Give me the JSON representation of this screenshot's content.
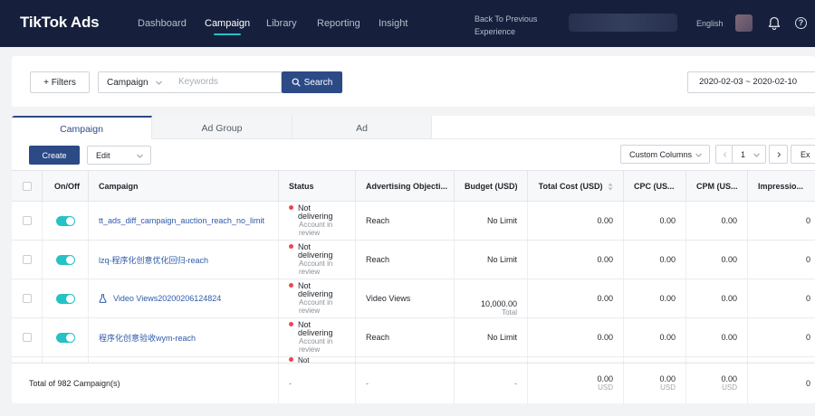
{
  "nav": {
    "logo": "TikTok Ads",
    "items": [
      "Dashboard",
      "Campaign",
      "Library",
      "Reporting",
      "Insight"
    ],
    "back_link": "Back To Previous Experience",
    "language": "English",
    "help": "?"
  },
  "filterbar": {
    "filters_label": "+ Filters",
    "level_select": "Campaign",
    "keywords_placeholder": "Keywords",
    "search_label": "Search",
    "date_range": "2020-02-03  ~  2020-02-10"
  },
  "tabs": [
    "Campaign",
    "Ad Group",
    "Ad"
  ],
  "toolbar": {
    "create_label": "Create",
    "edit_label": "Edit",
    "custom_columns_label": "Custom Columns",
    "page_value": "1",
    "export_label": "Ex"
  },
  "table": {
    "columns": [
      "",
      "On/Off",
      "Campaign",
      "Status",
      "Advertising Objecti...",
      "Budget (USD)",
      "Total Cost (USD)",
      "CPC (US...",
      "CPM (US...",
      "Impressio..."
    ],
    "rows": [
      {
        "campaign": "tt_ads_diff_campaign_auction_reach_no_limit",
        "status": "Not delivering",
        "status_sub": "Account in review",
        "objective": "Reach",
        "budget": "No Limit",
        "budget_sub": "",
        "total_cost": "0.00",
        "cpc": "0.00",
        "cpm": "0.00",
        "impressions": "0",
        "on": true
      },
      {
        "campaign": "lzq-程序化创意优化回归-reach",
        "status": "Not delivering",
        "status_sub": "Account in review",
        "objective": "Reach",
        "budget": "No Limit",
        "budget_sub": "",
        "total_cost": "0.00",
        "cpc": "0.00",
        "cpm": "0.00",
        "impressions": "0",
        "on": true
      },
      {
        "campaign": "Video Views20200206124824",
        "status": "Not delivering",
        "status_sub": "Account in review",
        "objective": "Video Views",
        "budget": "10,000.00",
        "budget_sub": "Total",
        "total_cost": "0.00",
        "cpc": "0.00",
        "cpm": "0.00",
        "impressions": "0",
        "on": true
      },
      {
        "campaign": "程序化创意验收wym-reach",
        "status": "Not delivering",
        "status_sub": "Account in review",
        "objective": "Reach",
        "budget": "No Limit",
        "budget_sub": "",
        "total_cost": "0.00",
        "cpc": "0.00",
        "cpm": "0.00",
        "impressions": "0",
        "on": true
      }
    ],
    "partial_row_status": "Not",
    "footer": {
      "total_label": "Total of 982 Campaign(s)",
      "status": "-",
      "objective": "-",
      "budget": "-",
      "total_cost": "0.00",
      "total_cost_unit": "USD",
      "cpc": "0.00",
      "cpc_unit": "USD",
      "cpm": "0.00",
      "cpm_unit": "USD",
      "impressions": "0"
    }
  },
  "colors": {
    "nav_bg": "#16203c",
    "primary": "#2b4a86",
    "toggle_on": "#25c2c6",
    "status_dot": "#f0454b",
    "link": "#2e5aa8"
  }
}
